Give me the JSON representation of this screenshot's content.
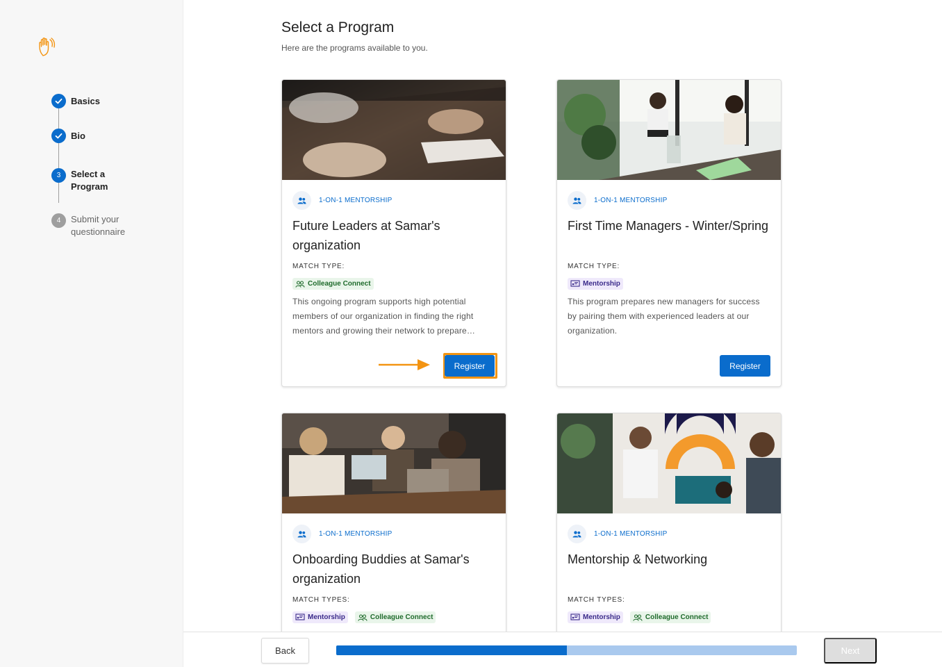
{
  "header": {
    "title": "Select a Program",
    "subtitle": "Here are the programs available to you."
  },
  "steps": [
    {
      "label": "Basics",
      "state": "done"
    },
    {
      "label": "Bio",
      "state": "done"
    },
    {
      "number": "3",
      "label_line1": "Select a",
      "label_line2": "Program",
      "state": "current"
    },
    {
      "number": "4",
      "label_line1": "Submit your",
      "label_line2": "questionnaire",
      "state": "todo"
    }
  ],
  "programs": [
    {
      "type": "1-ON-1 MENTORSHIP",
      "title": "Future Leaders at Samar's organization",
      "match_label": "MATCH TYPE:",
      "badges": [
        {
          "label": "Colleague Connect",
          "color": "green"
        }
      ],
      "description": "This ongoing program supports high potential members of our organization in finding the right mentors and growing their network to prepare…",
      "register_label": "Register"
    },
    {
      "type": "1-ON-1 MENTORSHIP",
      "title": "First Time Managers - Winter/Spring",
      "match_label": "MATCH TYPE:",
      "badges": [
        {
          "label": "Mentorship",
          "color": "purple"
        }
      ],
      "description": "This program prepares new managers for success by pairing them with experienced leaders at our organization.",
      "register_label": "Register"
    },
    {
      "type": "1-ON-1 MENTORSHIP",
      "title": "Onboarding Buddies at Samar's organization",
      "match_label": "MATCH TYPES:",
      "badges": [
        {
          "label": "Mentorship",
          "color": "purple"
        },
        {
          "label": "Colleague Connect",
          "color": "green"
        }
      ]
    },
    {
      "type": "1-ON-1 MENTORSHIP",
      "title": "Mentorship & Networking",
      "match_label": "MATCH TYPES:",
      "badges": [
        {
          "label": "Mentorship",
          "color": "purple"
        },
        {
          "label": "Colleague Connect",
          "color": "green"
        }
      ]
    }
  ],
  "footer": {
    "back_label": "Back",
    "next_label": "Next",
    "progress_fraction": 0.5
  },
  "colors": {
    "primary": "#0a6ccc",
    "highlight": "#f39412",
    "progress_track": "#a9c9ee"
  }
}
